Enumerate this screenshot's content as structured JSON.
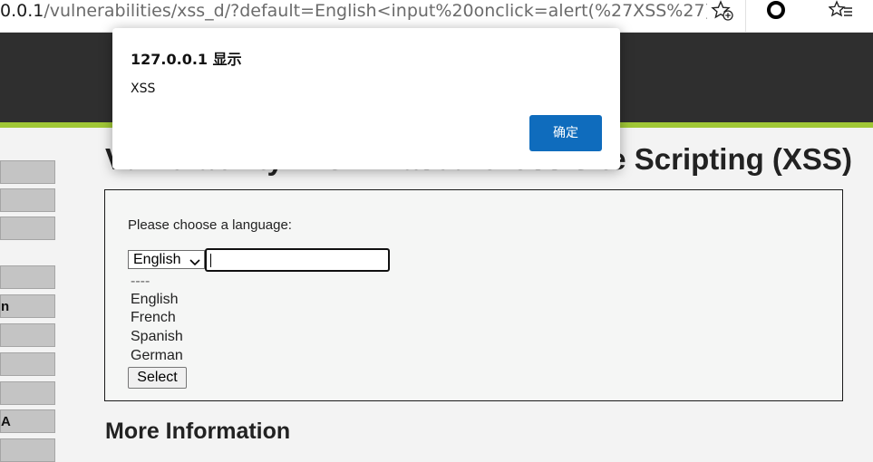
{
  "browser": {
    "url_host": "0.0.1",
    "url_rest": "/vulnerabilities/xss_d/?default=English<input%20onclick=alert(%27XSS%27)%20...",
    "icons": [
      "add-favorite-icon",
      "record-icon",
      "favorites-icon"
    ]
  },
  "colors": {
    "header": "#2f2f2f",
    "accent": "#a0c736",
    "dialog_button": "#0f6cbd"
  },
  "sidebar": {
    "items": [
      {
        "label": ""
      },
      {
        "label": ""
      },
      {
        "label": ""
      },
      {
        "label": ""
      },
      {
        "label": "n"
      },
      {
        "label": ""
      },
      {
        "label": ""
      },
      {
        "label": ""
      },
      {
        "label": "A"
      },
      {
        "label": ""
      }
    ]
  },
  "main": {
    "title": "Vulnerability: DOM Based Cross Site Scripting (XSS)",
    "prompt": "Please choose a language:",
    "selected_language": "English",
    "text_input_value": "",
    "options": [
      "----",
      "English",
      "French",
      "Spanish",
      "German"
    ],
    "select_button": "Select",
    "more_info": "More Information"
  },
  "dialog": {
    "title": "127.0.0.1 显示",
    "message": "XSS",
    "ok_label": "确定"
  }
}
